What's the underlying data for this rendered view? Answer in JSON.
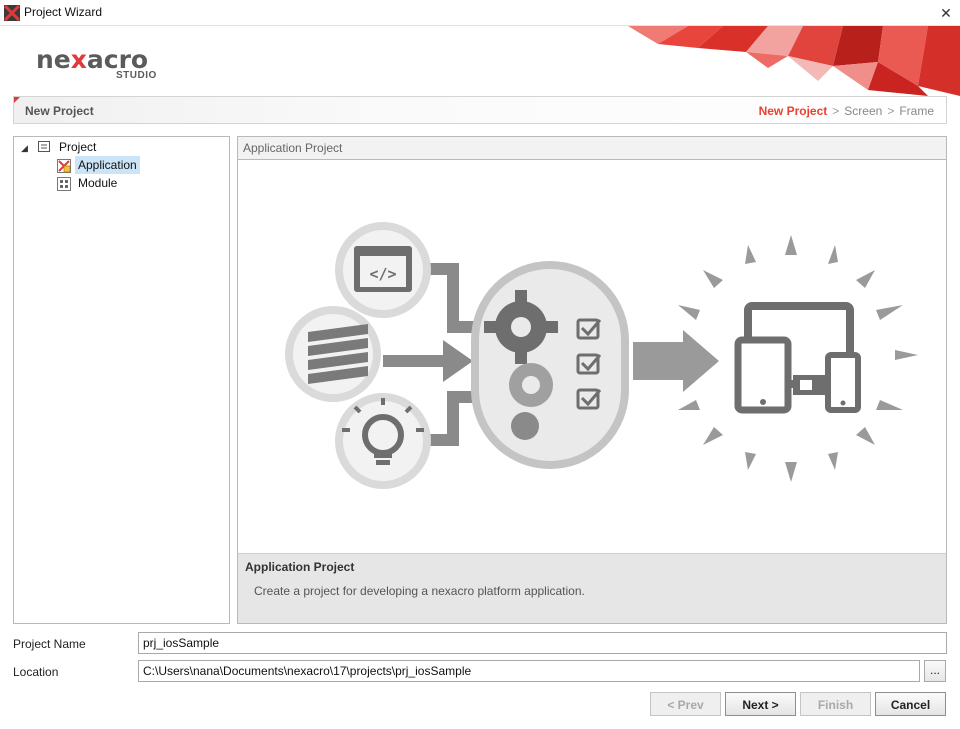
{
  "window": {
    "title": "Project Wizard",
    "close_glyph": "✕"
  },
  "logo": {
    "brand_pre": "ne",
    "brand_accent": "x",
    "brand_post": "acro",
    "sub": "STUDIO"
  },
  "stepbar": {
    "title": "New Project",
    "steps": [
      "New Project",
      "Screen",
      "Frame"
    ],
    "separator": ">",
    "active_step": "New Project"
  },
  "tree": {
    "root": {
      "label": "Project",
      "icon": "project-icon",
      "expander": "◢"
    },
    "children": [
      {
        "label": "Application",
        "icon": "application-icon",
        "selected": true
      },
      {
        "label": "Module",
        "icon": "module-icon",
        "selected": false
      }
    ]
  },
  "panel": {
    "header": "Application Project",
    "desc_title": "Application Project",
    "desc_text": "Create a project for developing a nexacro platform application."
  },
  "form": {
    "project_name_label": "Project Name",
    "project_name_value": "prj_iosSample",
    "location_label": "Location",
    "location_value": "C:\\Users\\nana\\Documents\\nexacro\\17\\projects\\prj_iosSample",
    "browse_label": "..."
  },
  "buttons": {
    "prev": "< Prev",
    "next": "Next >",
    "finish": "Finish",
    "cancel": "Cancel"
  },
  "colors": {
    "accent": "#e8412e",
    "selection": "#cce4f7",
    "illustration": "#7a7a7a"
  }
}
